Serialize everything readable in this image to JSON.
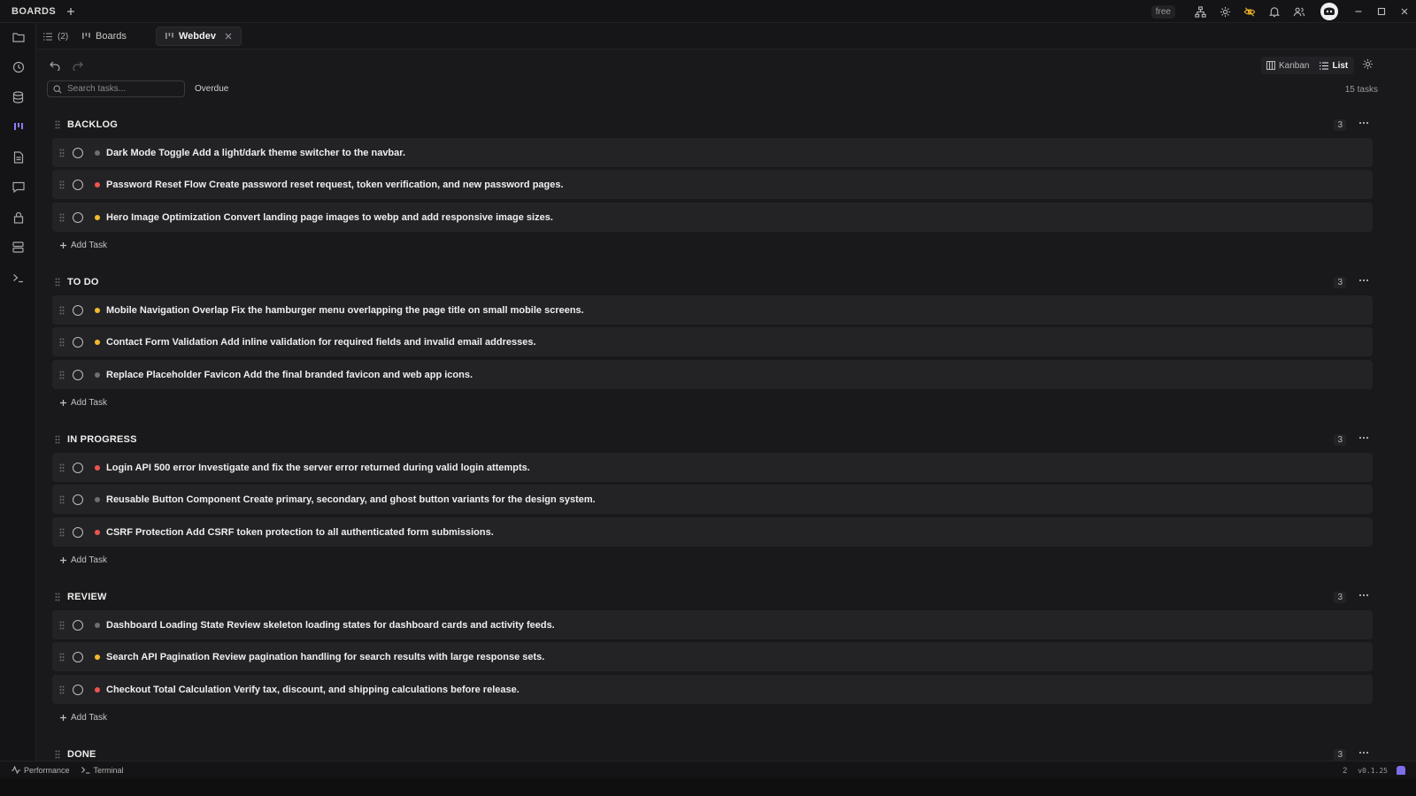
{
  "app": {
    "title": "BOARDS",
    "plan": "free",
    "version": "v0.1.25",
    "notifications_count": "2"
  },
  "tabs": [
    {
      "label": "(2)",
      "icon": "list-icon"
    },
    {
      "label": "Boards",
      "icon": "kanban-icon"
    },
    {
      "label": "Webdev",
      "icon": "kanban-icon",
      "active": true
    }
  ],
  "toolbar": {
    "search_placeholder": "Search tasks...",
    "filter_label": "Overdue",
    "view_kanban": "Kanban",
    "view_list": "List",
    "active_view": "List",
    "task_total": "15 tasks"
  },
  "priority_colors": {
    "high": "#ef5350",
    "medium": "#f5b92e",
    "low": "#6e6e72"
  },
  "accent_color": "#8b7cf6",
  "sections": [
    {
      "title": "BACKLOG",
      "count": "3",
      "tasks": [
        {
          "text": "Dark Mode Toggle Add a light/dark theme switcher to the navbar.",
          "priority": "low"
        },
        {
          "text": "Password Reset Flow Create password reset request, token verification, and new password pages.",
          "priority": "high"
        },
        {
          "text": "Hero Image Optimization Convert landing page images to webp and add responsive image sizes.",
          "priority": "medium"
        }
      ],
      "add_label": "Add Task"
    },
    {
      "title": "TO DO",
      "count": "3",
      "tasks": [
        {
          "text": "Mobile Navigation Overlap Fix the hamburger menu overlapping the page title on small mobile screens.",
          "priority": "medium"
        },
        {
          "text": "Contact Form Validation Add inline validation for required fields and invalid email addresses.",
          "priority": "medium"
        },
        {
          "text": "Replace Placeholder Favicon Add the final branded favicon and web app icons.",
          "priority": "low"
        }
      ],
      "add_label": "Add Task"
    },
    {
      "title": "IN PROGRESS",
      "count": "3",
      "tasks": [
        {
          "text": "Login API 500 error Investigate and fix the server error returned during valid login attempts.",
          "priority": "high"
        },
        {
          "text": "Reusable Button Component Create primary, secondary, and ghost button variants for the design system.",
          "priority": "low"
        },
        {
          "text": "CSRF Protection Add CSRF token protection to all authenticated form submissions.",
          "priority": "high"
        }
      ],
      "add_label": "Add Task"
    },
    {
      "title": "REVIEW",
      "count": "3",
      "tasks": [
        {
          "text": "Dashboard Loading State Review skeleton loading states for dashboard cards and activity feeds.",
          "priority": "low"
        },
        {
          "text": "Search API Pagination Review pagination handling for search results with large response sets.",
          "priority": "medium"
        },
        {
          "text": "Checkout Total Calculation Verify tax, discount, and shipping calculations before release.",
          "priority": "high"
        }
      ],
      "add_label": "Add Task"
    },
    {
      "title": "DONE",
      "count": "3",
      "tasks": [],
      "add_label": ""
    }
  ],
  "statusbar": {
    "performance": "Performance",
    "terminal": "Terminal"
  }
}
